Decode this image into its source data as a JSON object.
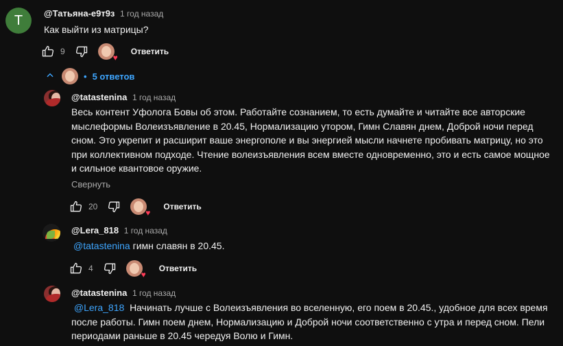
{
  "comments": {
    "top": {
      "avatar_letter": "Т",
      "author": "@Татьяна-е9т9з",
      "time": "1 год назад",
      "text": "Как выйти из матрицы?",
      "likes": "9",
      "reply_label": "Ответить"
    },
    "replies_toggle": {
      "dot": "•",
      "label": "5 ответов"
    },
    "reply1": {
      "author": "@tatastenina",
      "time": "1 год назад",
      "line1": "Весь контент Уфолога Бовы об этом. Работайте сознанием, то есть думайте и читайте все авторские",
      "line2": "мыслеформы Волеизъявление в 20.45, Нормализацию утором, Гимн Славян днем, Доброй ночи перед",
      "line3": "сном. Это укрепит и расширит ваше энергополе и вы энергией мысли начнете пробивать матрицу, но это",
      "line4": "при коллективном подходе. Чтение волеизъявления всем вместе одновременно, это и есть самое мощное",
      "line5": "и сильное квантовое оружие.",
      "collapse_label": "Свернуть",
      "likes": "20",
      "reply_label": "Ответить"
    },
    "reply2": {
      "author": "@Lera_818",
      "time": "1 год назад",
      "mention": "@tatastenina",
      "text": "гимн славян в 20.45.",
      "likes": "4",
      "reply_label": "Ответить"
    },
    "reply3": {
      "author": "@tatastenina",
      "time": "1 год назад",
      "mention": "@Lera_818",
      "line1": "Начинать лучше с Волеизъявления во вселенную, его поем в 20.45., удобное для всех время",
      "line2": "после работы. Гимн поем днем, Нормализацию и Доброй ночи соответственно с утра и перед сном. Пели",
      "line3": "периодами раньше в 20.45 чередуя Волю и Гимн."
    }
  },
  "colors": {
    "background": "#0f0f0f",
    "link": "#3ea6ff",
    "secondary_text": "#aaaaaa",
    "heart": "#ff3b57"
  },
  "icons": [
    "thumbs-up-icon",
    "thumbs-down-icon",
    "chevron-up-icon",
    "heart-icon"
  ]
}
